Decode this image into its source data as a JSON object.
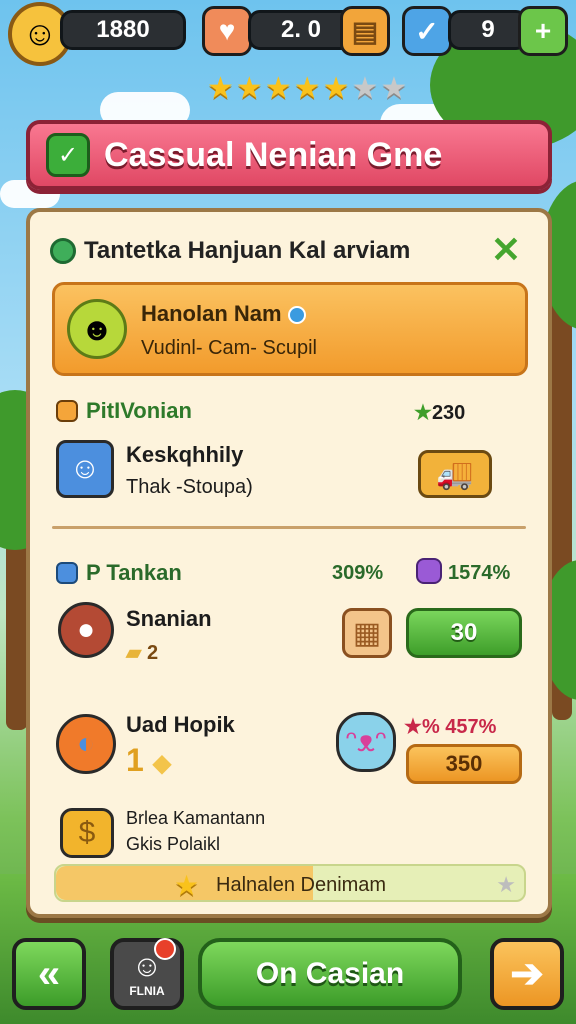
{
  "hud": {
    "coins": "1880",
    "hearts": "2. 0",
    "energy": "9"
  },
  "rating": {
    "stars_filled": 5,
    "stars_total": 7
  },
  "banner": {
    "title": "Cassual Nenian Gme"
  },
  "panel": {
    "title": "Tantetka Hanjuan Kal arviam",
    "hero": {
      "name": "Hanolan Nam",
      "subtitle": "Vudinl- Cam- Scupil"
    },
    "section1": {
      "heading": "PitIVonian",
      "reward": "230",
      "item": {
        "title": "Keskqhhily",
        "subtitle": "Thak -Stoupa)"
      }
    },
    "section2": {
      "heading": "P Tankan",
      "pct_a": "309%",
      "pct_b": "1574%",
      "items": [
        {
          "title": "Snanian",
          "subtitle": "2",
          "button": "30"
        },
        {
          "title": "Uad Hopik",
          "subtitle": "1",
          "stat": "% 457%",
          "button": "350"
        },
        {
          "title": "Brlea Kamantann",
          "subtitle": "Gkis Polaikl"
        }
      ]
    },
    "progress": {
      "label": "Halnalen Denimam",
      "fraction": 0.55
    }
  },
  "bottom": {
    "back_label": "",
    "friend_label": "FLNIA",
    "main_label": "On Casian",
    "next_label": ""
  },
  "colors": {
    "banner": "#e9526d",
    "panel_bg": "#fdf3dc",
    "green": "#3e9e2a",
    "orange": "#ec9624"
  }
}
